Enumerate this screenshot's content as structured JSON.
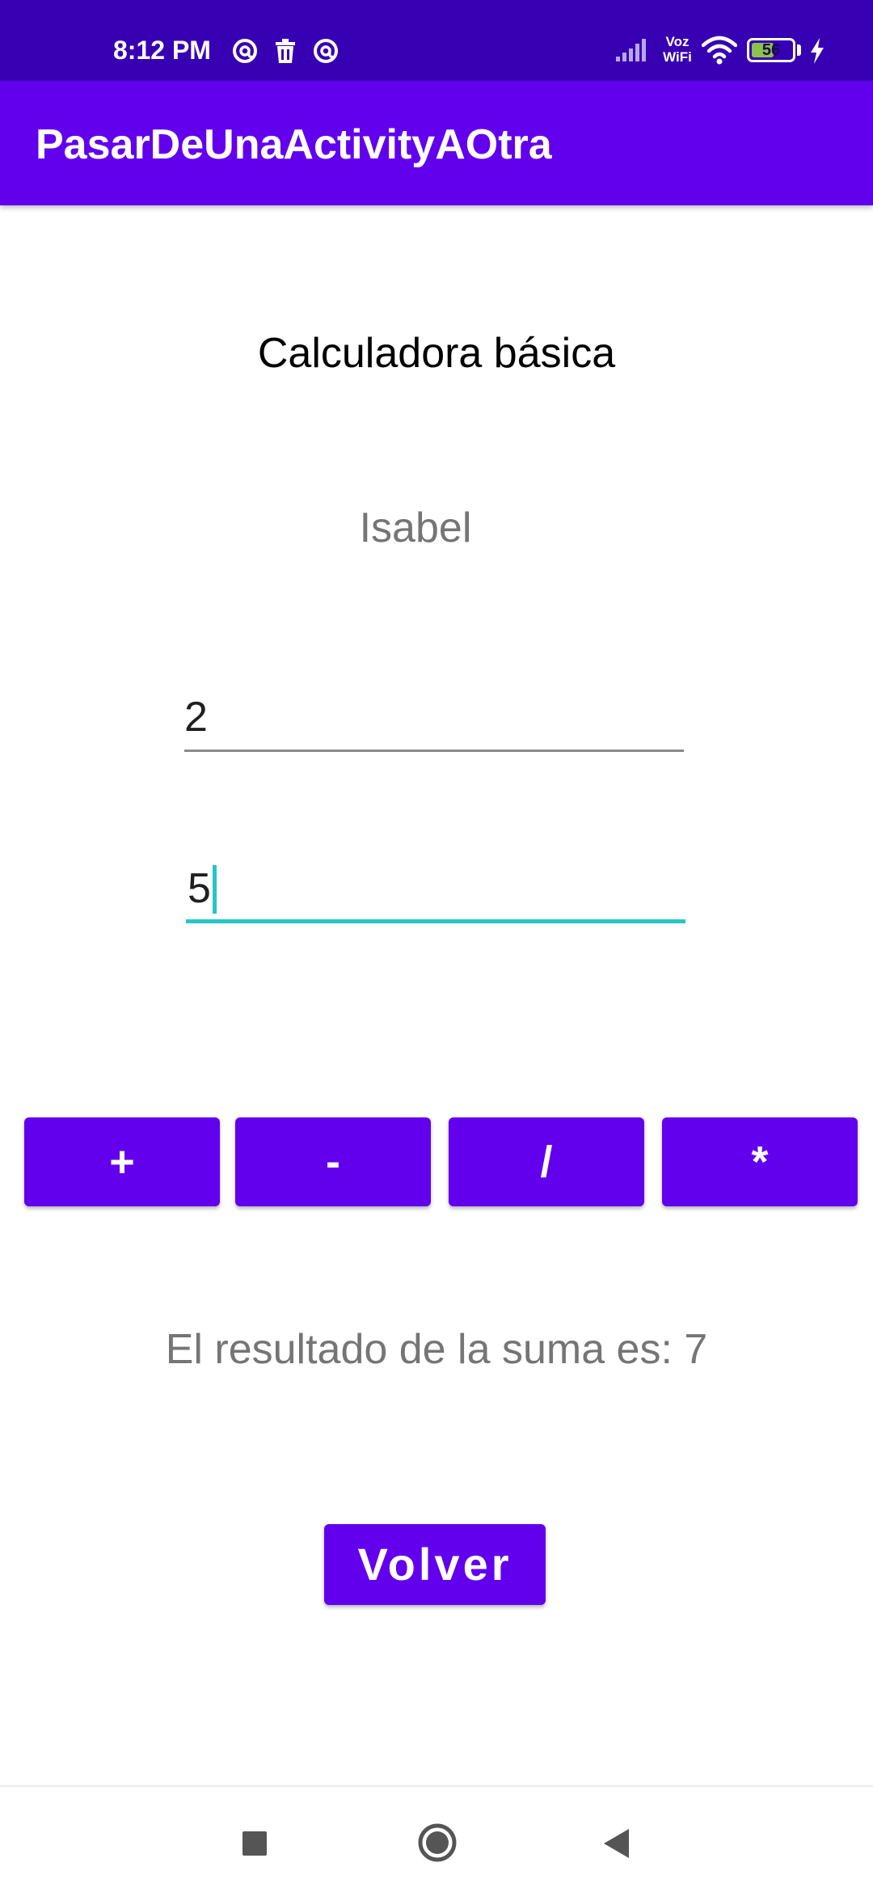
{
  "status_bar": {
    "time": "8:12 PM",
    "voz_top": "Voz",
    "voz_bottom": "WiFi",
    "battery_level": 56,
    "battery_text": "56",
    "icons": [
      "at-sign-icon",
      "trash-icon",
      "at-sign-icon",
      "signal-icon",
      "wifi-icon",
      "battery-icon",
      "charging-bolt-icon"
    ]
  },
  "app_bar": {
    "title": "PasarDeUnaActivityAOtra"
  },
  "main": {
    "heading": "Calculadora básica",
    "name": "Isabel",
    "input_1": {
      "value": "2"
    },
    "input_2": {
      "value": "5"
    },
    "operations": [
      {
        "label": "+"
      },
      {
        "label": "-"
      },
      {
        "label": "/"
      },
      {
        "label": "*"
      }
    ],
    "result": "El resultado de la suma es: 7",
    "back_label": "Volver"
  },
  "nav_bar": {
    "icons": [
      "recents-square-icon",
      "home-circle-icon",
      "back-triangle-icon"
    ]
  },
  "colors": {
    "status_bar": "#3700b3",
    "primary": "#6200ee",
    "accent": "#26c6c6",
    "secondary_text": "#757575"
  }
}
